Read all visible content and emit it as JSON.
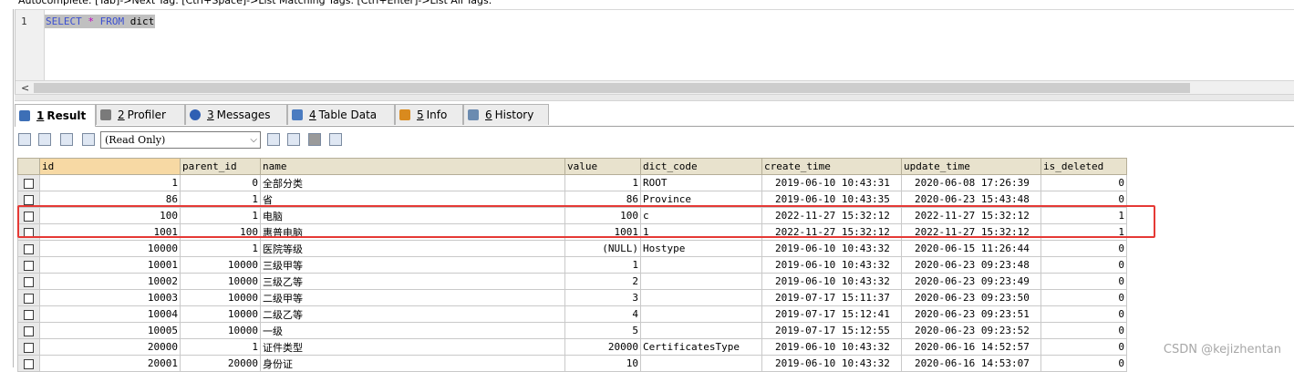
{
  "hint": "Autocomplete: [Tab]->Next Tag. [Ctrl+Space]->List Matching Tags. [Ctrl+Enter]->List All Tags.",
  "editor": {
    "line_number": "1",
    "sql_keyword1": "SELECT",
    "sql_star": "*",
    "sql_keyword2": "FROM",
    "sql_table": "dict",
    "scroll_left": "<"
  },
  "tabs": [
    {
      "num": "1",
      "label": "Result",
      "icon": "grid-icon",
      "color": "#3d6fb6"
    },
    {
      "num": "2",
      "label": "Profiler",
      "icon": "profiler-icon",
      "color": "#7a7a7a"
    },
    {
      "num": "3",
      "label": "Messages",
      "icon": "info-circle-icon",
      "color": "#2f5fb3"
    },
    {
      "num": "4",
      "label": "Table Data",
      "icon": "table-icon",
      "color": "#4a7bc0"
    },
    {
      "num": "5",
      "label": "Info",
      "icon": "chart-icon",
      "color": "#d98a1e"
    },
    {
      "num": "6",
      "label": "History",
      "icon": "calendar-icon",
      "color": "#6b8bb0"
    }
  ],
  "toolbar": {
    "mode_select": "(Read Only)",
    "dropdown_arrow": "⌵"
  },
  "grid": {
    "columns": [
      "id",
      "parent_id",
      "name",
      "value",
      "dict_code",
      "create_time",
      "update_time",
      "is_deleted"
    ],
    "rows": [
      [
        "1",
        "0",
        "全部分类",
        "1",
        "ROOT",
        "2019-06-10 10:43:31",
        "2020-06-08 17:26:39",
        "0"
      ],
      [
        "86",
        "1",
        "省",
        "86",
        "Province",
        "2019-06-10 10:43:35",
        "2020-06-23 15:43:48",
        "0"
      ],
      [
        "100",
        "1",
        "电脑",
        "100",
        "c",
        "2022-11-27 15:32:12",
        "2022-11-27 15:32:12",
        "1"
      ],
      [
        "1001",
        "100",
        "惠普电脑",
        "1001",
        "1",
        "2022-11-27 15:32:12",
        "2022-11-27 15:32:12",
        "1"
      ],
      [
        "10000",
        "1",
        "医院等级",
        "(NULL)",
        "Hostype",
        "2019-06-10 10:43:32",
        "2020-06-15 11:26:44",
        "0"
      ],
      [
        "10001",
        "10000",
        "三级甲等",
        "1",
        "",
        "2019-06-10 10:43:32",
        "2020-06-23 09:23:48",
        "0"
      ],
      [
        "10002",
        "10000",
        "三级乙等",
        "2",
        "",
        "2019-06-10 10:43:32",
        "2020-06-23 09:23:49",
        "0"
      ],
      [
        "10003",
        "10000",
        "二级甲等",
        "3",
        "",
        "2019-07-17 15:11:37",
        "2020-06-23 09:23:50",
        "0"
      ],
      [
        "10004",
        "10000",
        "二级乙等",
        "4",
        "",
        "2019-07-17 15:12:41",
        "2020-06-23 09:23:51",
        "0"
      ],
      [
        "10005",
        "10000",
        "一级",
        "5",
        "",
        "2019-07-17 15:12:55",
        "2020-06-23 09:23:52",
        "0"
      ],
      [
        "20000",
        "1",
        "证件类型",
        "20000",
        "CertificatesType",
        "2019-06-10 10:43:32",
        "2020-06-16 14:52:57",
        "0"
      ],
      [
        "20001",
        "20000",
        "身份证",
        "10",
        "",
        "2019-06-10 10:43:32",
        "2020-06-16 14:53:07",
        "0"
      ]
    ],
    "highlight_color": "#e53935"
  },
  "watermark": "CSDN @kejizhentan"
}
